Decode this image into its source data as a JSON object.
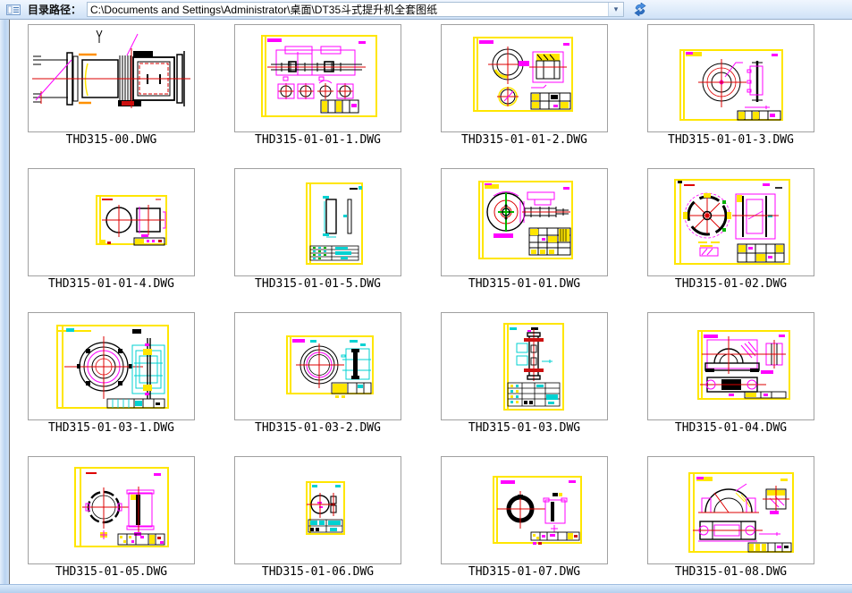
{
  "toolbar": {
    "label": "目录路径：",
    "path": "C:\\Documents and Settings\\Administrator\\桌面\\DT35斗式提升机全套图纸",
    "dropdown_glyph": "▾",
    "icons": [
      "directory-list-icon",
      "chevron-down-icon",
      "refresh-sync-icon"
    ]
  },
  "colors": {
    "toolbar_blue": "#cfe2f7",
    "cad_yellow": "#ffe600",
    "cad_magenta": "#ff00ff",
    "cad_red": "#dd0000",
    "cad_cyan": "#00d2d2",
    "cad_green": "#00b300"
  },
  "files": [
    {
      "name": "THD315-00.DWG"
    },
    {
      "name": "THD315-01-01-1.DWG"
    },
    {
      "name": "THD315-01-01-2.DWG"
    },
    {
      "name": "THD315-01-01-3.DWG"
    },
    {
      "name": "THD315-01-01-4.DWG"
    },
    {
      "name": "THD315-01-01-5.DWG"
    },
    {
      "name": "THD315-01-01.DWG"
    },
    {
      "name": "THD315-01-02.DWG"
    },
    {
      "name": "THD315-01-03-1.DWG"
    },
    {
      "name": "THD315-01-03-2.DWG"
    },
    {
      "name": "THD315-01-03.DWG"
    },
    {
      "name": "THD315-01-04.DWG"
    },
    {
      "name": "THD315-01-05.DWG"
    },
    {
      "name": "THD315-01-06.DWG"
    },
    {
      "name": "THD315-01-07.DWG"
    },
    {
      "name": "THD315-01-08.DWG"
    }
  ]
}
